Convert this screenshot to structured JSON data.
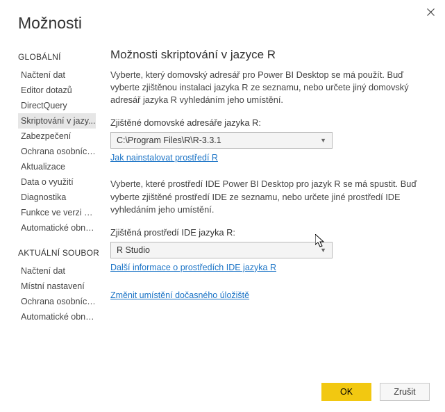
{
  "window": {
    "title": "Možnosti"
  },
  "sidebar": {
    "section1": "GLOBÁLNÍ",
    "items1": [
      "Načtení dat",
      "Editor dotazů",
      "DirectQuery",
      "Skriptování v jazy...",
      "Zabezpečení",
      "Ochrana osobních...",
      "Aktualizace",
      "Data o využití",
      "Diagnostika",
      "Funkce ve verzi Pre...",
      "Automatické obnov..."
    ],
    "section2": "AKTUÁLNÍ SOUBOR",
    "items2": [
      "Načtení dat",
      "Místní nastavení",
      "Ochrana osobních...",
      "Automatické obnov..."
    ],
    "selectedIndex": 3
  },
  "main": {
    "title": "Možnosti skriptování v jazyce R",
    "para1": "Vyberte, který domovský adresář pro Power BI Desktop se má použít. Buď vyberte zjištěnou instalaci jazyka R ze seznamu, nebo určete jiný domovský adresář jazyka R vyhledáním jeho umístění.",
    "label1": "Zjištěné domovské adresáře jazyka R:",
    "combo1": "C:\\Program Files\\R\\R-3.3.1",
    "link1": "Jak nainstalovat prostředí R",
    "para2": "Vyberte, které prostředí IDE Power BI Desktop pro jazyk R se má spustit. Buď vyberte zjištěné prostředí IDE ze seznamu, nebo určete jiné prostředí IDE vyhledáním jeho umístění.",
    "label2": "Zjištěná prostředí IDE jazyka R:",
    "combo2": "R Studio",
    "link2": "Další informace o prostředích IDE jazyka R",
    "link3": "Změnit umístění dočasného úložiště"
  },
  "footer": {
    "ok": "OK",
    "cancel": "Zrušit"
  }
}
